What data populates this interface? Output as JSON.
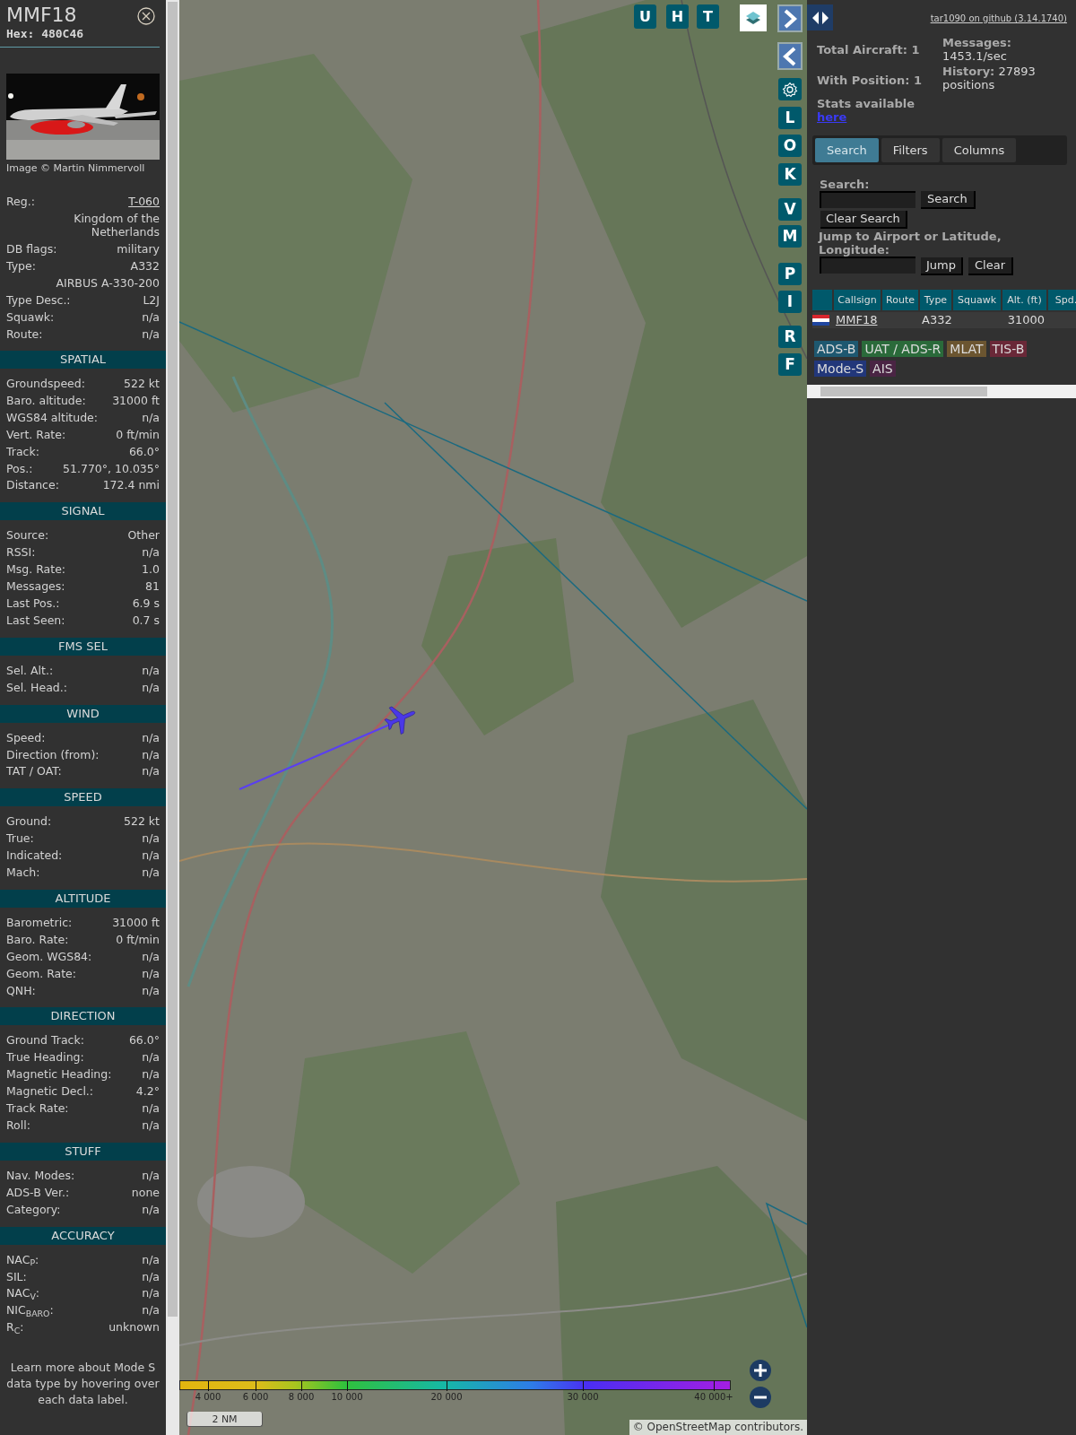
{
  "detail_panel": {
    "callsign": "MMF18",
    "hex": "Hex: 480C46",
    "photo_credit": "Image © Martin Nimmervoll",
    "rows": [
      {
        "kind": "link",
        "label": "Reg.:",
        "value": "T-060"
      },
      {
        "kind": "value",
        "value": "Kingdom of the Netherlands"
      },
      {
        "kind": "pair",
        "label": "DB flags:",
        "value": "military"
      },
      {
        "kind": "pair",
        "label": "Type:",
        "value": "A332"
      },
      {
        "kind": "value",
        "value": "AIRBUS A-330-200"
      },
      {
        "kind": "pair",
        "label": "Type Desc.:",
        "value": "L2J"
      },
      {
        "kind": "pair",
        "label": "Squawk:",
        "value": "n/a"
      },
      {
        "kind": "pair",
        "label": "Route:",
        "value": "n/a"
      }
    ],
    "sections": [
      {
        "title": "SPATIAL",
        "rows": [
          {
            "label": "Groundspeed:",
            "value": "522 kt"
          },
          {
            "label": "Baro. altitude:",
            "value": "31000 ft"
          },
          {
            "label": "WGS84 altitude:",
            "value": "n/a"
          },
          {
            "label": "Vert. Rate:",
            "value": "0 ft/min"
          },
          {
            "label": "Track:",
            "value": "66.0°"
          },
          {
            "label": "Pos.:",
            "value": "51.770°, 10.035°"
          },
          {
            "label": "Distance:",
            "value": "172.4 nmi"
          }
        ]
      },
      {
        "title": "SIGNAL",
        "rows": [
          {
            "label": "Source:",
            "value": "Other"
          },
          {
            "label": "RSSI:",
            "value": "n/a"
          },
          {
            "label": "Msg. Rate:",
            "value": "1.0"
          },
          {
            "label": "Messages:",
            "value": "81"
          },
          {
            "label": "Last Pos.:",
            "value": "6.9 s"
          },
          {
            "label": "Last Seen:",
            "value": "0.7 s"
          }
        ]
      },
      {
        "title": "FMS SEL",
        "rows": [
          {
            "label": "Sel. Alt.:",
            "value": "n/a"
          },
          {
            "label": "Sel. Head.:",
            "value": "n/a"
          }
        ]
      },
      {
        "title": "WIND",
        "rows": [
          {
            "label": "Speed:",
            "value": "n/a"
          },
          {
            "label": "Direction (from):",
            "value": "n/a"
          },
          {
            "label": "TAT / OAT:",
            "value": "n/a"
          }
        ]
      },
      {
        "title": "SPEED",
        "rows": [
          {
            "label": "Ground:",
            "value": "522 kt"
          },
          {
            "label": "True:",
            "value": "n/a"
          },
          {
            "label": "Indicated:",
            "value": "n/a"
          },
          {
            "label": "Mach:",
            "value": "n/a"
          }
        ]
      },
      {
        "title": "ALTITUDE",
        "rows": [
          {
            "label": "Barometric:",
            "value": "31000 ft"
          },
          {
            "label": "Baro. Rate:",
            "value": "0 ft/min"
          },
          {
            "label": "Geom. WGS84:",
            "value": "n/a"
          },
          {
            "label": "Geom. Rate:",
            "value": "n/a"
          },
          {
            "label": "QNH:",
            "value": "n/a"
          }
        ]
      },
      {
        "title": "DIRECTION",
        "rows": [
          {
            "label": "Ground Track:",
            "value": "66.0°"
          },
          {
            "label": "True Heading:",
            "value": "n/a"
          },
          {
            "label": "Magnetic Heading:",
            "value": "n/a"
          },
          {
            "label": "Magnetic Decl.:",
            "value": "4.2°"
          },
          {
            "label": "Track Rate:",
            "value": "n/a"
          },
          {
            "label": "Roll:",
            "value": "n/a"
          }
        ]
      },
      {
        "title": "STUFF",
        "rows": [
          {
            "label": "Nav. Modes:",
            "value": "n/a"
          },
          {
            "label": "ADS-B Ver.:",
            "value": "none"
          },
          {
            "label": "Category:",
            "value": "n/a"
          }
        ]
      },
      {
        "title": "ACCURACY",
        "rows": [
          {
            "label": "NAC$_{P}$:",
            "value": "n/a"
          },
          {
            "label": "SIL:",
            "value": "n/a"
          },
          {
            "label": "NAC$_{V}$:",
            "value": "n/a"
          },
          {
            "label": "NIC$_{BARO}$:",
            "value": "n/a"
          },
          {
            "label": "R$_{C}$:",
            "value": "unknown"
          }
        ]
      }
    ],
    "note": "Learn more about Mode S data type by hovering over each data label."
  },
  "map": {
    "top_buttons": [
      "U",
      "H",
      "T"
    ],
    "side_buttons": [
      "L",
      "O",
      "K",
      "V",
      "M",
      "P",
      "I",
      "R",
      "F"
    ],
    "altitude_legend": [
      "4 000",
      "6 000",
      "8 000",
      "10 000",
      "20 000",
      "30 000",
      "40 000+"
    ],
    "scale": "2 NM",
    "attribution": "© OpenStreetMap contributors."
  },
  "sidebar": {
    "version_link": "tar1090 on github (3.14.1740)",
    "stats_left": [
      "Total Aircraft: 1",
      "With Position: 1"
    ],
    "stats_right": [
      "**Messages:** 1453.1/sec",
      "**History:** 27893 positions"
    ],
    "stats_text": "Stats available",
    "stats_link": "here",
    "tabs": [
      {
        "label": "Search",
        "selected": true
      },
      {
        "label": "Filters",
        "selected": false
      },
      {
        "label": "Columns",
        "selected": false
      }
    ],
    "search_label": "Search:",
    "search_button": "Search",
    "clear_search_button": "Clear Search",
    "jump_label": "Jump to Airport or Latitude, Longitude:",
    "jump_button": "Jump",
    "clear_button": "Clear",
    "table": {
      "columns": [
        "Callsign",
        "Route",
        "Type",
        "Squawk",
        "Alt. (ft)",
        "Spd."
      ],
      "rows": [
        {
          "callsign": "MMF18",
          "type": "A332",
          "altitude": "31000"
        }
      ]
    },
    "source_tags": [
      {
        "label": "ADS-B",
        "color": "#1e5870"
      },
      {
        "label": "UAT / ADS-R",
        "color": "#2a6a3a"
      },
      {
        "label": "MLAT",
        "color": "#6b5530"
      },
      {
        "label": "TIS-B",
        "color": "#6a2838"
      },
      {
        "label": "Mode-S",
        "color": "#22377a"
      },
      {
        "label": "AIS",
        "color": "#4a2444"
      }
    ]
  }
}
